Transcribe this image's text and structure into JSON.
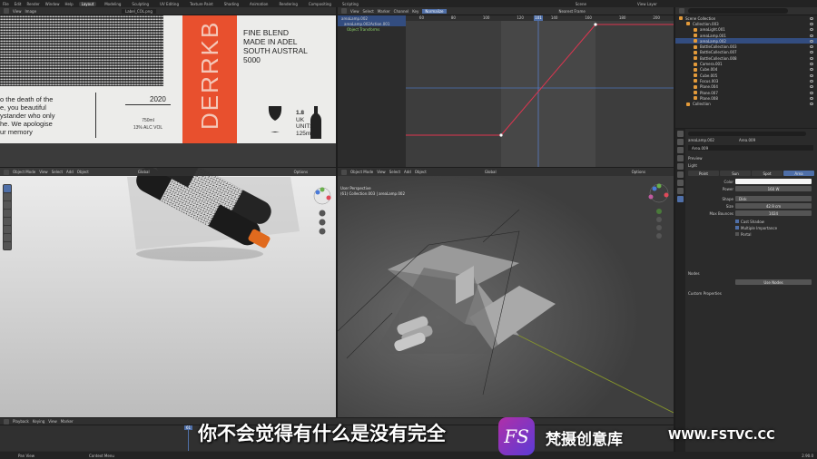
{
  "topbar": {
    "menus": [
      "File",
      "Edit",
      "Render",
      "Window",
      "Help"
    ],
    "workspaces": [
      "Layout",
      "Modeling",
      "Sculpting",
      "UV Editing",
      "Texture Paint",
      "Shading",
      "Animation",
      "Rendering",
      "Compositing",
      "Scripting"
    ],
    "active_workspace": "Layout",
    "scene": "Scene",
    "view_layer": "View Layer"
  },
  "image_editor": {
    "header_items": [
      "View",
      "Image"
    ],
    "image_name": "Label_COL.png",
    "label": {
      "poem_lines": [
        "o the death of the",
        "e, you beautiful",
        "ystander who only",
        "he. We apologise",
        "ur memory"
      ],
      "vintage": "2020",
      "volume": "750ml",
      "abv": "13% ALC VOL",
      "brand_vertical": "DERRKB",
      "blend_lines": [
        "FINE BLEND",
        "MADE IN ADEL",
        "SOUTH AUSTRAL",
        "5000"
      ],
      "units_lines": [
        "1.8",
        "UK",
        "UNITS",
        "125ml"
      ]
    }
  },
  "graph_editor": {
    "header_items": [
      "View",
      "Select",
      "Marker",
      "Channel",
      "Key"
    ],
    "normalize": "Normalize",
    "mode": "Nearest Frame",
    "current_frame": "101",
    "frame_ticks": [
      "60",
      "80",
      "100",
      "120",
      "140",
      "160",
      "180",
      "200",
      "220",
      "240"
    ],
    "channels": [
      {
        "label": "areaLamp.002",
        "selected": true,
        "green": false
      },
      {
        "label": "areaLamp.002Action.001",
        "selected": true,
        "green": false
      },
      {
        "label": "Object Transforms",
        "selected": false,
        "green": true
      }
    ]
  },
  "outliner": {
    "rows": [
      {
        "label": "Scene Collection",
        "selected": false,
        "indent": 0
      },
      {
        "label": "Collection.003",
        "selected": false,
        "indent": 1
      },
      {
        "label": "areaLight.001",
        "selected": false,
        "indent": 2
      },
      {
        "label": "areaLamp.001",
        "selected": false,
        "indent": 2
      },
      {
        "label": "areaLamp.002",
        "selected": true,
        "indent": 2
      },
      {
        "label": "BottleCollection.003",
        "selected": false,
        "indent": 2
      },
      {
        "label": "BottleCollection.007",
        "selected": false,
        "indent": 2
      },
      {
        "label": "BottleCollection.008",
        "selected": false,
        "indent": 2
      },
      {
        "label": "Camera.001",
        "selected": false,
        "indent": 2
      },
      {
        "label": "Cube.004",
        "selected": false,
        "indent": 2
      },
      {
        "label": "Cube.005",
        "selected": false,
        "indent": 2
      },
      {
        "label": "Focus.003",
        "selected": false,
        "indent": 2
      },
      {
        "label": "Plane.004",
        "selected": false,
        "indent": 2
      },
      {
        "label": "Plane.007",
        "selected": false,
        "indent": 2
      },
      {
        "label": "Plane.008",
        "selected": false,
        "indent": 2
      },
      {
        "label": "Collection",
        "selected": false,
        "indent": 1
      }
    ]
  },
  "properties": {
    "object_name": "areaLamp.002",
    "data_name": "Area.009",
    "panel_preview": "Preview",
    "panel_light": "Light",
    "light_types": [
      "Point",
      "Sun",
      "Spot",
      "Area"
    ],
    "active_light_type": "Area",
    "fields": [
      {
        "label": "Color",
        "value": ""
      },
      {
        "label": "Power",
        "value": "160 W"
      },
      {
        "label": "Shape",
        "value": "Disk"
      },
      {
        "label": "Size",
        "value": "42.9 cm"
      },
      {
        "label": "Max Bounces",
        "value": "1024"
      }
    ],
    "checkboxes": [
      "Cast Shadow",
      "Multiple Importance",
      "Portal"
    ],
    "panel_nodes": "Nodes",
    "use_nodes": "Use Nodes",
    "panel_custom": "Custom Properties"
  },
  "viewport_left": {
    "mode": "Object Mode",
    "header_items": [
      "View",
      "Select",
      "Add",
      "Object"
    ],
    "transform": "Global",
    "options": "Options"
  },
  "viewport_right": {
    "mode": "Object Mode",
    "header_items": [
      "View",
      "Select",
      "Add",
      "Object"
    ],
    "transform": "Global",
    "options": "Options",
    "overlay_title": "User Perspective",
    "overlay_path": "(61) Collection.003 | areaLamp.002"
  },
  "timeline": {
    "header_items": [
      "Playback",
      "Keying",
      "View",
      "Marker"
    ],
    "current_frame": "61",
    "start": "1",
    "end": "250",
    "status_left": "Pan View",
    "status_right": "Context Menu",
    "version": "2.90.0"
  },
  "subtitle": "你不会觉得有什么是没有完全",
  "watermark": {
    "logo": "FS",
    "name": "梵摄创意库",
    "url": "WWW.FSTVC.CC"
  },
  "colors": {
    "accent_blue": "#4f6fa8",
    "selection": "#334d80",
    "label_orange": "#e8502e",
    "fcurve": "#e03550"
  }
}
